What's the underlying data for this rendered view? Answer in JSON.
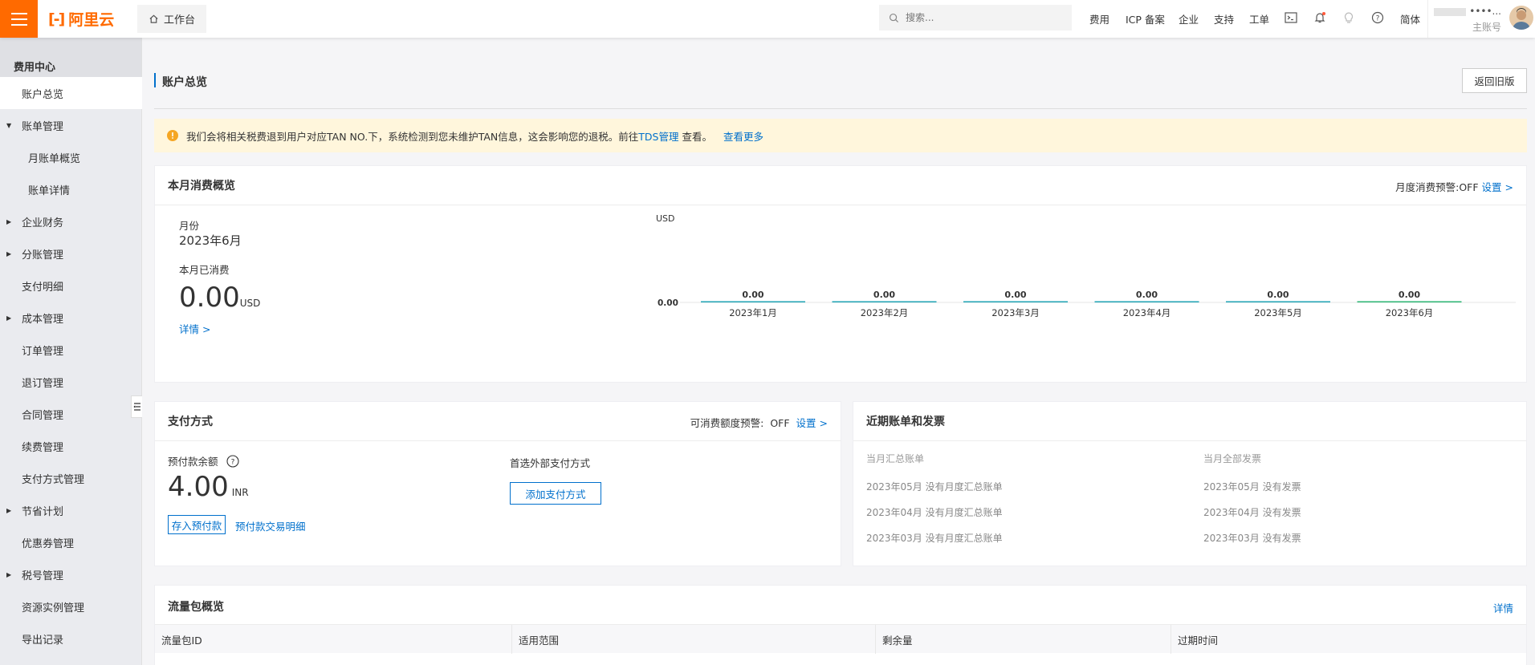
{
  "topbar": {
    "logo_text": "阿里云",
    "workbench_label": "工作台",
    "search_placeholder": "搜索...",
    "nav": [
      "费用",
      "ICP 备案",
      "企业",
      "支持",
      "工单"
    ],
    "lang": "简体",
    "account_name": "••••...",
    "account_role": "主账号",
    "accent": "#ff6a00"
  },
  "sidebar": {
    "title": "费用中心",
    "items": [
      {
        "label": "账户总览",
        "active": true,
        "arrow": ""
      },
      {
        "label": "账单管理",
        "arrow": "down"
      },
      {
        "label": "月账单概览",
        "sub": true,
        "arrow": ""
      },
      {
        "label": "账单详情",
        "sub": true,
        "arrow": ""
      },
      {
        "label": "企业财务",
        "arrow": "right"
      },
      {
        "label": "分账管理",
        "arrow": "right"
      },
      {
        "label": "支付明细",
        "arrow": ""
      },
      {
        "label": "成本管理",
        "arrow": "right"
      },
      {
        "label": "订单管理",
        "arrow": ""
      },
      {
        "label": "退订管理",
        "arrow": ""
      },
      {
        "label": "合同管理",
        "arrow": ""
      },
      {
        "label": "续费管理",
        "arrow": ""
      },
      {
        "label": "支付方式管理",
        "arrow": ""
      },
      {
        "label": "节省计划",
        "arrow": "right"
      },
      {
        "label": "优惠券管理",
        "arrow": ""
      },
      {
        "label": "税号管理",
        "arrow": "right"
      },
      {
        "label": "资源实例管理",
        "arrow": ""
      },
      {
        "label": "导出记录",
        "arrow": ""
      }
    ]
  },
  "page": {
    "title": "账户总览",
    "back_button": "返回旧版"
  },
  "notice": {
    "text": "我们会将相关税费退到用户对应TAN NO.下，系统检测到您未维护TAN信息，这会影响您的退税。前往",
    "link": "TDS管理",
    "after": "查看。",
    "more": "查看更多",
    "bg": "#fff8e1"
  },
  "monthly": {
    "title": "本月消费概览",
    "alert_label": "月度消费预警:OFF",
    "alert_link": "设置 >",
    "month_label": "月份",
    "month_value": "2023年6月",
    "spent_label": "本月已消费",
    "spent_value": "0.00",
    "spent_unit": "USD",
    "detail_link": "详情 >"
  },
  "chart_data": {
    "type": "bar",
    "ylabel": "USD",
    "ytick": "0.00",
    "categories": [
      "2023年1月",
      "2023年2月",
      "2023年3月",
      "2023年4月",
      "2023年5月",
      "2023年6月"
    ],
    "values": [
      0.0,
      0.0,
      0.0,
      0.0,
      0.0,
      0.0
    ],
    "value_labels": [
      "0.00",
      "0.00",
      "0.00",
      "0.00",
      "0.00",
      "0.00"
    ],
    "bar_color": "#1fa3b5",
    "last_bar_color": "#2bb673"
  },
  "payment": {
    "title": "支付方式",
    "alert_label": "可消费额度预警:",
    "alert_state": "OFF",
    "alert_link": "设置 >",
    "balance_label": "预付款余额",
    "help_icon": "question-circle-icon",
    "balance_value": "4.00",
    "balance_unit": "INR",
    "deposit_button": "存入预付款",
    "details_link": "预付款交易明细",
    "preferred_label": "首选外部支付方式",
    "add_method_button": "添加支付方式"
  },
  "bills": {
    "title": "近期账单和发票",
    "col1_header": "当月汇总账单",
    "col2_header": "当月全部发票",
    "col1": [
      "2023年05月 没有月度汇总账单",
      "2023年04月 没有月度汇总账单",
      "2023年03月 没有月度汇总账单"
    ],
    "col2": [
      "2023年05月 没有发票",
      "2023年04月 没有发票",
      "2023年03月 没有发票"
    ]
  },
  "traffic": {
    "title": "流量包概览",
    "detail_link": "详情",
    "columns": [
      "流量包ID",
      "适用范围",
      "剩余量",
      "过期时间"
    ]
  }
}
